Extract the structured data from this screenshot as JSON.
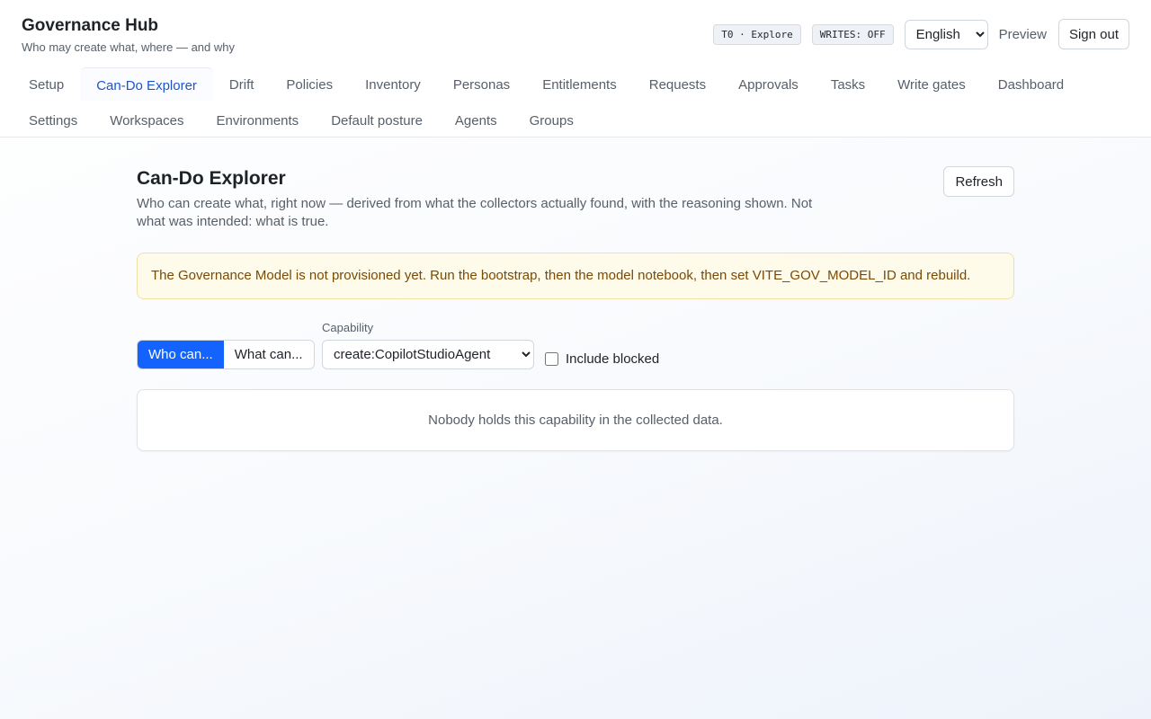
{
  "app": {
    "title": "Governance Hub",
    "subtitle": "Who may create what, where — and why"
  },
  "topbar": {
    "mode_badge": "T0 · Explore",
    "writes_badge": "WRITES: OFF",
    "language": {
      "selected": "English",
      "options": [
        "English"
      ]
    },
    "preview_label": "Preview",
    "signout_label": "Sign out"
  },
  "nav": {
    "row1": [
      {
        "label": "Setup"
      },
      {
        "label": "Can-Do Explorer",
        "active": true
      },
      {
        "label": "Drift"
      },
      {
        "label": "Policies"
      },
      {
        "label": "Inventory"
      },
      {
        "label": "Personas"
      },
      {
        "label": "Entitlements"
      },
      {
        "label": "Requests"
      },
      {
        "label": "Approvals"
      },
      {
        "label": "Tasks"
      },
      {
        "label": "Write gates"
      },
      {
        "label": "Dashboard"
      }
    ],
    "row2": [
      {
        "label": "Settings"
      },
      {
        "label": "Workspaces"
      },
      {
        "label": "Environments"
      },
      {
        "label": "Default posture"
      },
      {
        "label": "Agents"
      },
      {
        "label": "Groups"
      }
    ]
  },
  "page": {
    "title": "Can-Do Explorer",
    "description": "Who can create what, right now — derived from what the collectors actually found, with the reasoning shown. Not what was intended: what is true.",
    "refresh_label": "Refresh",
    "alert": "The Governance Model is not provisioned yet. Run the bootstrap, then the model notebook, then set VITE_GOV_MODEL_ID and rebuild.",
    "mode_toggle": {
      "who_label": "Who can...",
      "what_label": "What can...",
      "active": "who"
    },
    "capability": {
      "label": "Capability",
      "selected": "create:CopilotStudioAgent",
      "options": [
        "create:CopilotStudioAgent"
      ]
    },
    "include_blocked_label": "Include blocked",
    "include_blocked": false,
    "empty_message": "Nobody holds this capability in the collected data."
  },
  "colors": {
    "accent": "#1463ff",
    "active_tab": "#1f55c7",
    "alert_bg": "#fffbea",
    "alert_text": "#7a4a05"
  }
}
